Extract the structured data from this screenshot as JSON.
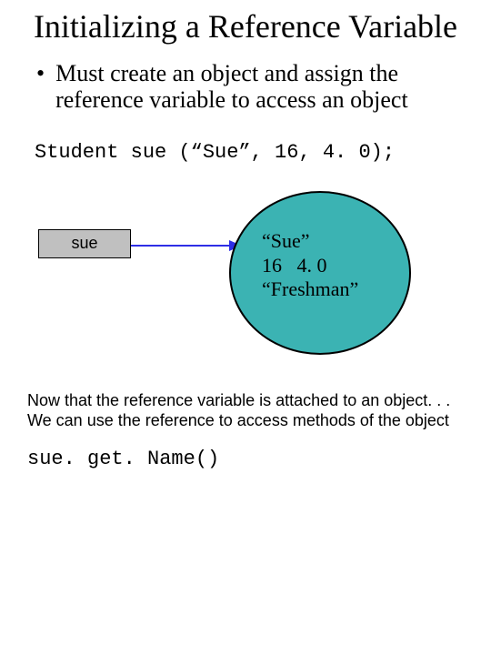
{
  "title": "Initializing a Reference Variable",
  "bullet": {
    "marker": "•",
    "text": "Must create an object and assign the reference variable to access an object"
  },
  "code_declaration": "Student sue (“Sue”, 16, 4. 0);",
  "diagram": {
    "ref_label": "sue",
    "object_lines": {
      "l1": "“Sue”",
      "l2": "16   4. 0",
      "l3": "“Freshman”"
    }
  },
  "footer_text": "Now that the reference variable is attached to an object. . . We can use the reference to access methods of the object",
  "method_call": "sue. get. Name()",
  "colors": {
    "ellipse_fill": "#3bb3b3",
    "box_fill": "#c0c0c0",
    "arrow_stroke": "#2e2ee6"
  }
}
